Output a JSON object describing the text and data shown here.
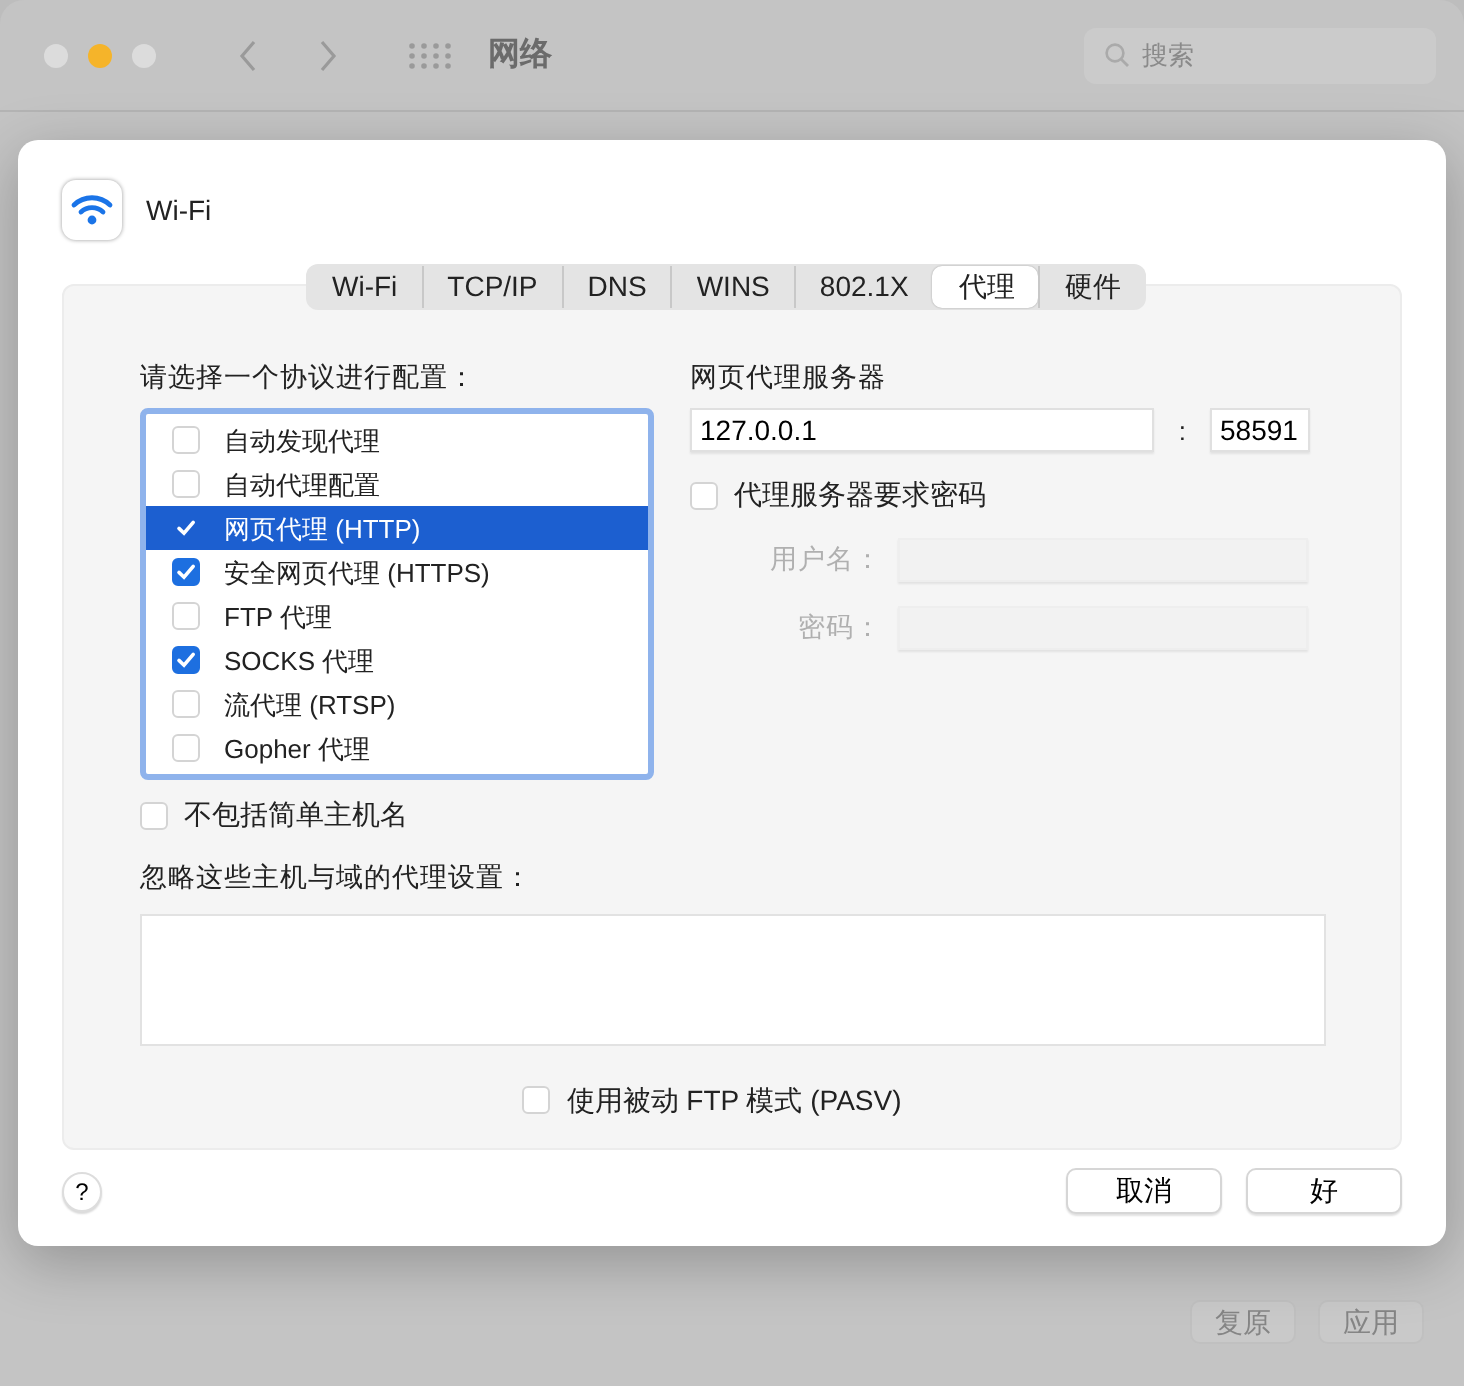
{
  "window": {
    "title": "网络",
    "search_placeholder": "搜索",
    "buttons": [
      {
        "label": "复原",
        "disabled": true
      },
      {
        "label": "应用",
        "disabled": true
      }
    ]
  },
  "sheet": {
    "interface": "Wi-Fi",
    "tabs": [
      {
        "label": "Wi-Fi",
        "selected": false
      },
      {
        "label": "TCP/IP",
        "selected": false
      },
      {
        "label": "DNS",
        "selected": false
      },
      {
        "label": "WINS",
        "selected": false
      },
      {
        "label": "802.1X",
        "selected": false
      },
      {
        "label": "代理",
        "selected": true
      },
      {
        "label": "硬件",
        "selected": false
      }
    ],
    "protocols_label": "请选择一个协议进行配置：",
    "protocols": [
      {
        "label": "自动发现代理",
        "checked": false,
        "selected": false
      },
      {
        "label": "自动代理配置",
        "checked": false,
        "selected": false
      },
      {
        "label": "网页代理 (HTTP)",
        "checked": true,
        "selected": true
      },
      {
        "label": "安全网页代理 (HTTPS)",
        "checked": true,
        "selected": false
      },
      {
        "label": "FTP 代理",
        "checked": false,
        "selected": false
      },
      {
        "label": "SOCKS 代理",
        "checked": true,
        "selected": false
      },
      {
        "label": "流代理 (RTSP)",
        "checked": false,
        "selected": false
      },
      {
        "label": "Gopher 代理",
        "checked": false,
        "selected": false
      }
    ],
    "server_label": "网页代理服务器",
    "server": "127.0.0.1",
    "port_separator": ":",
    "port": "58591",
    "requires_password": {
      "label": "代理服务器要求密码",
      "checked": false
    },
    "username": {
      "label": "用户名：",
      "disabled": true
    },
    "password": {
      "label": "密码：",
      "disabled": true
    },
    "exclude_simple": {
      "label": "不包括简单主机名",
      "checked": false
    },
    "bypass_label": "忽略这些主机与域的代理设置：",
    "pasv": {
      "label": "使用被动 FTP 模式 (PASV)",
      "checked": false
    },
    "help": "?",
    "buttons": [
      {
        "label": "取消"
      },
      {
        "label": "好"
      }
    ]
  }
}
